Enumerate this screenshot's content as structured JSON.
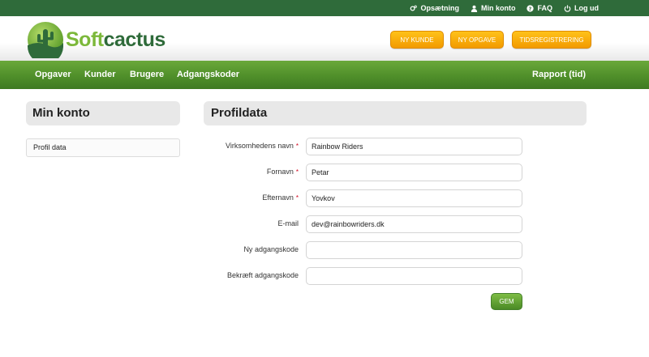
{
  "colors": {
    "topbar": "#2f6b3a",
    "nav_green": "#4f8f2a",
    "button_orange": "#f29a00",
    "logo_light_green": "#7cb83a",
    "logo_dark_green": "#2f6b3a",
    "required_red": "#d0021b"
  },
  "topbar": {
    "links": [
      {
        "label": "Opsætning",
        "icon": "gears-icon"
      },
      {
        "label": "Min konto",
        "icon": "user-icon"
      },
      {
        "label": "FAQ",
        "icon": "question-icon"
      },
      {
        "label": "Log ud",
        "icon": "power-icon"
      }
    ]
  },
  "header": {
    "logo": {
      "part1": "Soft",
      "part2": "cactus",
      "icon": "cactus-logo-icon"
    },
    "buttons": [
      "NY KUNDE",
      "NY OPGAVE",
      "TIDSREGISTRERING"
    ]
  },
  "nav": {
    "items": [
      "Opgaver",
      "Kunder",
      "Brugere",
      "Adgangskoder"
    ],
    "right": "Rapport (tid)"
  },
  "sidebar": {
    "title": "Min konto",
    "items": [
      "Profil data"
    ]
  },
  "main": {
    "title": "Profildata",
    "fields": [
      {
        "label": "Virksomhedens navn",
        "required": "*",
        "value": "Rainbow Riders"
      },
      {
        "label": "Fornavn",
        "required": "*",
        "value": "Petar"
      },
      {
        "label": "Efternavn",
        "required": "*",
        "value": "Yovkov"
      },
      {
        "label": "E-mail",
        "required": "",
        "value": "dev@rainbowriders.dk"
      },
      {
        "label": "Ny adgangskode",
        "required": "",
        "value": ""
      },
      {
        "label": "Bekræft adgangskode",
        "required": "",
        "value": ""
      }
    ],
    "save_label": "GEM"
  }
}
